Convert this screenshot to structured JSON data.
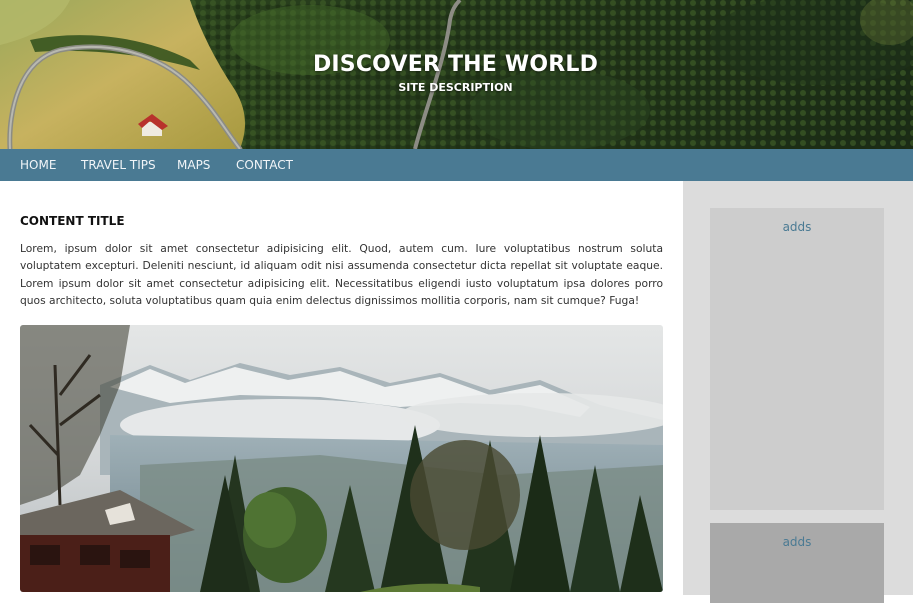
{
  "header": {
    "title": "DISCOVER THE WORLD",
    "description": "SITE DESCRIPTION"
  },
  "nav": {
    "items": [
      {
        "label": "HOME"
      },
      {
        "label": "TRAVEL TIPS"
      },
      {
        "label": "MAPS"
      },
      {
        "label": "CONTACT"
      }
    ],
    "background": "#4a7a93"
  },
  "content": {
    "title": "CONTENT TITLE",
    "body": "Lorem, ipsum dolor sit amet consectetur adipisicing elit. Quod, autem cum. Iure voluptatibus nostrum soluta voluptatem excepturi. Deleniti nesciunt, id aliquam odit nisi assumenda consectetur dicta repellat sit voluptate eaque. Lorem ipsum dolor sit amet consectetur adipisicing elit. Necessitatibus eligendi iusto voluptatum ipsa dolores porro quos architecto, soluta voluptatibus quam quia enim delectus dignissimos mollitia corporis, nam sit cumque? Fuga!"
  },
  "sidebar": {
    "ads": [
      {
        "label": "adds"
      },
      {
        "label": "adds"
      }
    ]
  }
}
